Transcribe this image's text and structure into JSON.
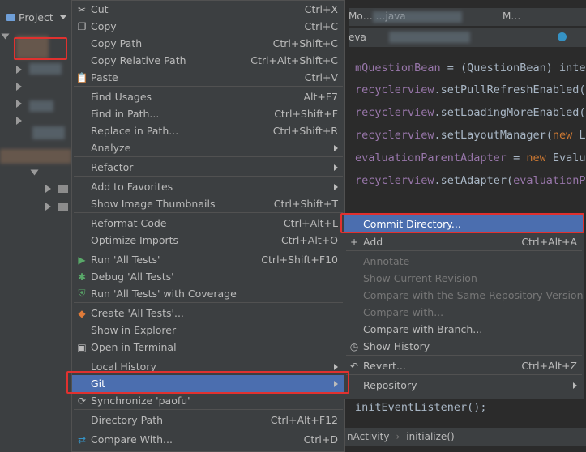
{
  "project": {
    "tab_label": "Project"
  },
  "editor": {
    "tab_1": "Mo…  …java",
    "tab_2": "M…",
    "breadcrumb_tab": "eva",
    "lines": [
      [
        "mQuestionBean = (QuestionBean) inter"
      ],
      [
        "recyclerview.setPullRefreshEnabled(f"
      ],
      [
        "recyclerview.setLoadingMoreEnabled(f"
      ],
      [
        "recyclerview.setLayoutManager(new Li"
      ],
      [
        "evaluationParentAdapter = new Evalua"
      ],
      [
        "recyclerview.setAdapter(evaluationPa"
      ]
    ],
    "bottom_line": "initEventListener();",
    "status_left": "nActivity",
    "status_right": "initialize()"
  },
  "context_menu": {
    "items": [
      {
        "label": "Cut",
        "shortcut": "Ctrl+X",
        "icon": "scissors-icon"
      },
      {
        "label": "Copy",
        "shortcut": "Ctrl+C",
        "icon": "copy-icon"
      },
      {
        "label": "Copy Path",
        "shortcut": "Ctrl+Shift+C"
      },
      {
        "label": "Copy Relative Path",
        "shortcut": "Ctrl+Alt+Shift+C"
      },
      {
        "label": "Paste",
        "shortcut": "Ctrl+V",
        "icon": "paste-icon"
      },
      {
        "label": "Find Usages",
        "shortcut": "Alt+F7"
      },
      {
        "label": "Find in Path...",
        "shortcut": "Ctrl+Shift+F"
      },
      {
        "label": "Replace in Path...",
        "shortcut": "Ctrl+Shift+R"
      },
      {
        "label": "Analyze",
        "shortcut": ""
      },
      {
        "label": "Refactor",
        "shortcut": ""
      },
      {
        "label": "Add to Favorites",
        "shortcut": ""
      },
      {
        "label": "Show Image Thumbnails",
        "shortcut": "Ctrl+Shift+T"
      },
      {
        "label": "Reformat Code",
        "shortcut": "Ctrl+Alt+L"
      },
      {
        "label": "Optimize Imports",
        "shortcut": "Ctrl+Alt+O"
      },
      {
        "label": "Run 'All Tests'",
        "shortcut": "Ctrl+Shift+F10",
        "icon": "run-icon"
      },
      {
        "label": "Debug 'All Tests'",
        "shortcut": "",
        "icon": "debug-icon"
      },
      {
        "label": "Run 'All Tests' with Coverage",
        "shortcut": "",
        "icon": "coverage-icon"
      },
      {
        "label": "Create 'All Tests'...",
        "shortcut": "",
        "icon": "create-test-icon"
      },
      {
        "label": "Show in Explorer",
        "shortcut": ""
      },
      {
        "label": "Open in Terminal",
        "shortcut": "",
        "icon": "terminal-icon"
      },
      {
        "label": "Local History",
        "shortcut": ""
      },
      {
        "label": "Git",
        "shortcut": ""
      },
      {
        "label": "Synchronize 'paofu'",
        "shortcut": "",
        "icon": "sync-icon"
      },
      {
        "label": "Directory Path",
        "shortcut": "Ctrl+Alt+F12"
      },
      {
        "label": "Compare With...",
        "shortcut": "Ctrl+D",
        "icon": "compare-icon"
      }
    ]
  },
  "git_menu": {
    "items": [
      {
        "label": "Commit Directory...",
        "shortcut": ""
      },
      {
        "label": "Add",
        "shortcut": "Ctrl+Alt+A",
        "icon": "plus-icon"
      },
      {
        "label": "Annotate",
        "shortcut": ""
      },
      {
        "label": "Show Current Revision",
        "shortcut": ""
      },
      {
        "label": "Compare with the Same Repository Version",
        "shortcut": ""
      },
      {
        "label": "Compare with...",
        "shortcut": ""
      },
      {
        "label": "Compare with Branch...",
        "shortcut": ""
      },
      {
        "label": "Show History",
        "shortcut": "",
        "icon": "history-icon"
      },
      {
        "label": "Revert...",
        "shortcut": "Ctrl+Alt+Z",
        "icon": "revert-icon"
      },
      {
        "label": "Repository",
        "shortcut": ""
      }
    ]
  },
  "colors": {
    "selection": "#4b6eaf",
    "highlight_box": "#e0312f",
    "menu_bg": "#3c3f41",
    "editor_bg": "#2b2b2b"
  }
}
